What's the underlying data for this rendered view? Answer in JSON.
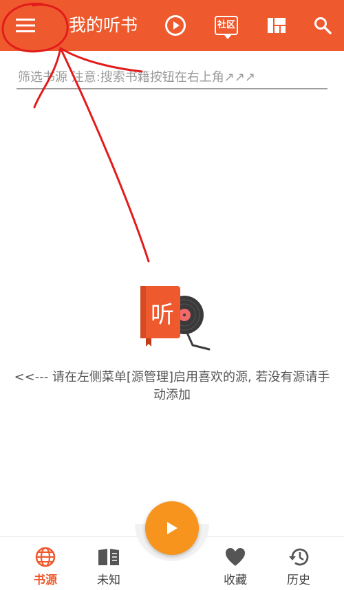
{
  "appbar": {
    "title": "我的听书",
    "community_label": "社区",
    "background": "#ee5a2e"
  },
  "filter": {
    "placeholder": "筛选书源 注意:搜索书籍按钮在右上角↗↗↗",
    "value": ""
  },
  "empty_state": {
    "logo_text": "听",
    "message": "<<--- 请在左侧菜单[源管理]启用喜欢的源, 若没有源请手动添加"
  },
  "bottom_nav": {
    "items": [
      {
        "label": "书源",
        "icon": "globe-icon",
        "active": true
      },
      {
        "label": "未知",
        "icon": "book-icon",
        "active": false
      },
      {
        "label": "收藏",
        "icon": "heart-icon",
        "active": false
      },
      {
        "label": "历史",
        "icon": "history-icon",
        "active": false
      }
    ]
  },
  "fab": {
    "icon": "play-icon",
    "color": "#f7941d"
  },
  "colors": {
    "accent": "#ee5a2e",
    "fab": "#f7941d",
    "annotation": "#e21b1b"
  }
}
